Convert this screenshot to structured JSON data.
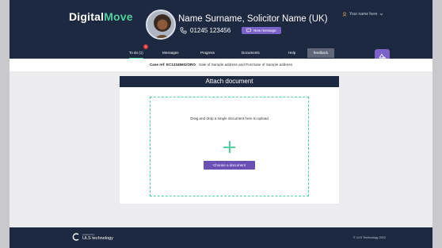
{
  "brand": {
    "logo_white": "Digital",
    "logo_green": "Move"
  },
  "profile": {
    "name": "Name Surname, Solicitor Name (UK)",
    "phone": "01245 123456",
    "new_message_label": "New message"
  },
  "user": {
    "label": "Your name here"
  },
  "nav": {
    "tabs": [
      {
        "label": "To do (1)"
      },
      {
        "label": "Messages"
      },
      {
        "label": "Progress"
      },
      {
        "label": "Documents"
      },
      {
        "label": "Help"
      }
    ],
    "todo_badge": "1",
    "feedback_label": "feedback"
  },
  "case": {
    "ref_label": "Case ref: EC123456G/ORO",
    "ref_description": " - Sale of Sample address and Purchase of Sample address"
  },
  "attach": {
    "title": "Attach document",
    "instruction": "Drag and drop a single document here to upload",
    "button_label": "Choose a document"
  },
  "footer": {
    "powered_by": "powered by",
    "company": "ULS technology",
    "copyright": "© ULS Technology 2022"
  },
  "colors": {
    "navy": "#1c2941",
    "green": "#4fcf9e",
    "purple": "#6a4fb5",
    "badge": "#e23a3a"
  },
  "icons": [
    "avatar",
    "phone-icon",
    "message-icon",
    "user-icon",
    "chevron-down-icon",
    "fab-icon",
    "plus-icon",
    "uls-logo-icon"
  ]
}
